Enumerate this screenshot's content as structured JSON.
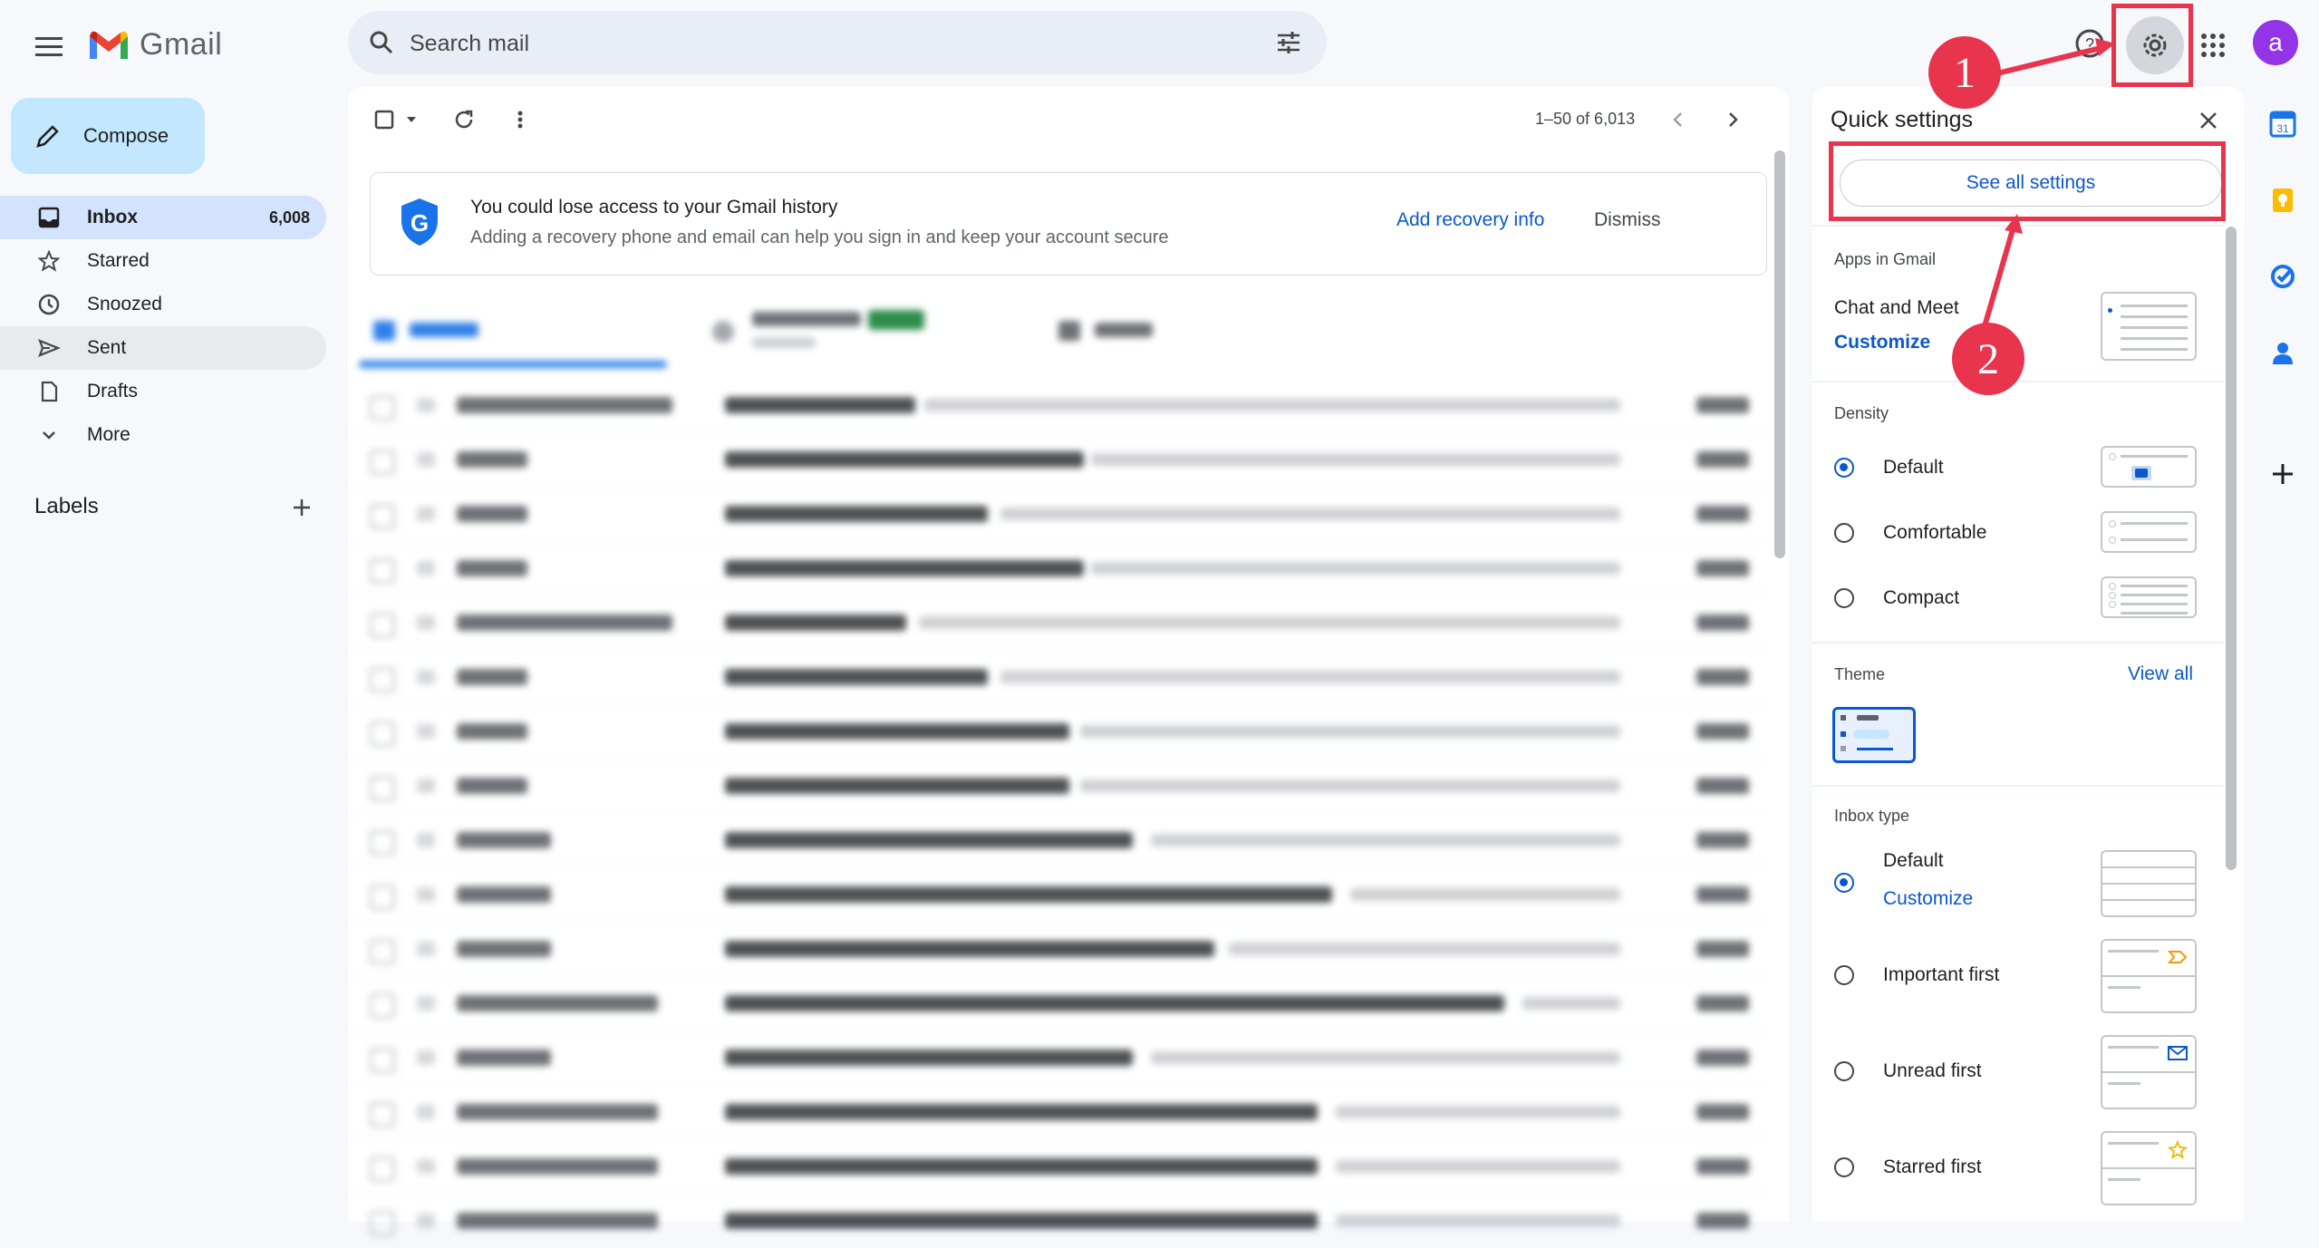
{
  "app": {
    "name": "Gmail"
  },
  "search": {
    "placeholder": "Search mail"
  },
  "header": {
    "avatar_letter": "a",
    "avatar_color": "#9334e6"
  },
  "sidebar": {
    "compose_label": "Compose",
    "items": [
      {
        "label": "Inbox",
        "count": "6,008",
        "icon": "inbox-icon"
      },
      {
        "label": "Starred",
        "count": "",
        "icon": "star-icon"
      },
      {
        "label": "Snoozed",
        "count": "",
        "icon": "clock-icon"
      },
      {
        "label": "Sent",
        "count": "",
        "icon": "send-icon"
      },
      {
        "label": "Drafts",
        "count": "",
        "icon": "draft-icon"
      },
      {
        "label": "More",
        "count": "",
        "icon": "chevron-down-icon"
      }
    ],
    "labels_title": "Labels"
  },
  "toolbar": {
    "pagination": "1–50 of 6,013"
  },
  "banner": {
    "title": "You could lose access to your Gmail history",
    "text": "Adding a recovery phone and email can help you sign in and keep your account secure",
    "recovery_label": "Add recovery info",
    "dismiss_label": "Dismiss"
  },
  "quick_settings": {
    "title": "Quick settings",
    "see_all": "See all settings",
    "apps_heading": "Apps in Gmail",
    "apps_item": "Chat and Meet",
    "apps_customize": "Customize",
    "density_heading": "Density",
    "density_options": [
      {
        "label": "Default",
        "selected": true
      },
      {
        "label": "Comfortable",
        "selected": false
      },
      {
        "label": "Compact",
        "selected": false
      }
    ],
    "theme_heading": "Theme",
    "theme_view_all": "View all",
    "inbox_type_heading": "Inbox type",
    "inbox_types": [
      {
        "label": "Default",
        "selected": true,
        "link": "Customize"
      },
      {
        "label": "Important first",
        "selected": false
      },
      {
        "label": "Unread first",
        "selected": false
      },
      {
        "label": "Starred first",
        "selected": false
      }
    ]
  },
  "annotations": {
    "step1": "1",
    "step2": "2",
    "color": "#e8344d"
  },
  "colors": {
    "accent": "#0b57d0",
    "compose_bg": "#c2e7ff",
    "inbox_active": "#d3e3fd"
  }
}
